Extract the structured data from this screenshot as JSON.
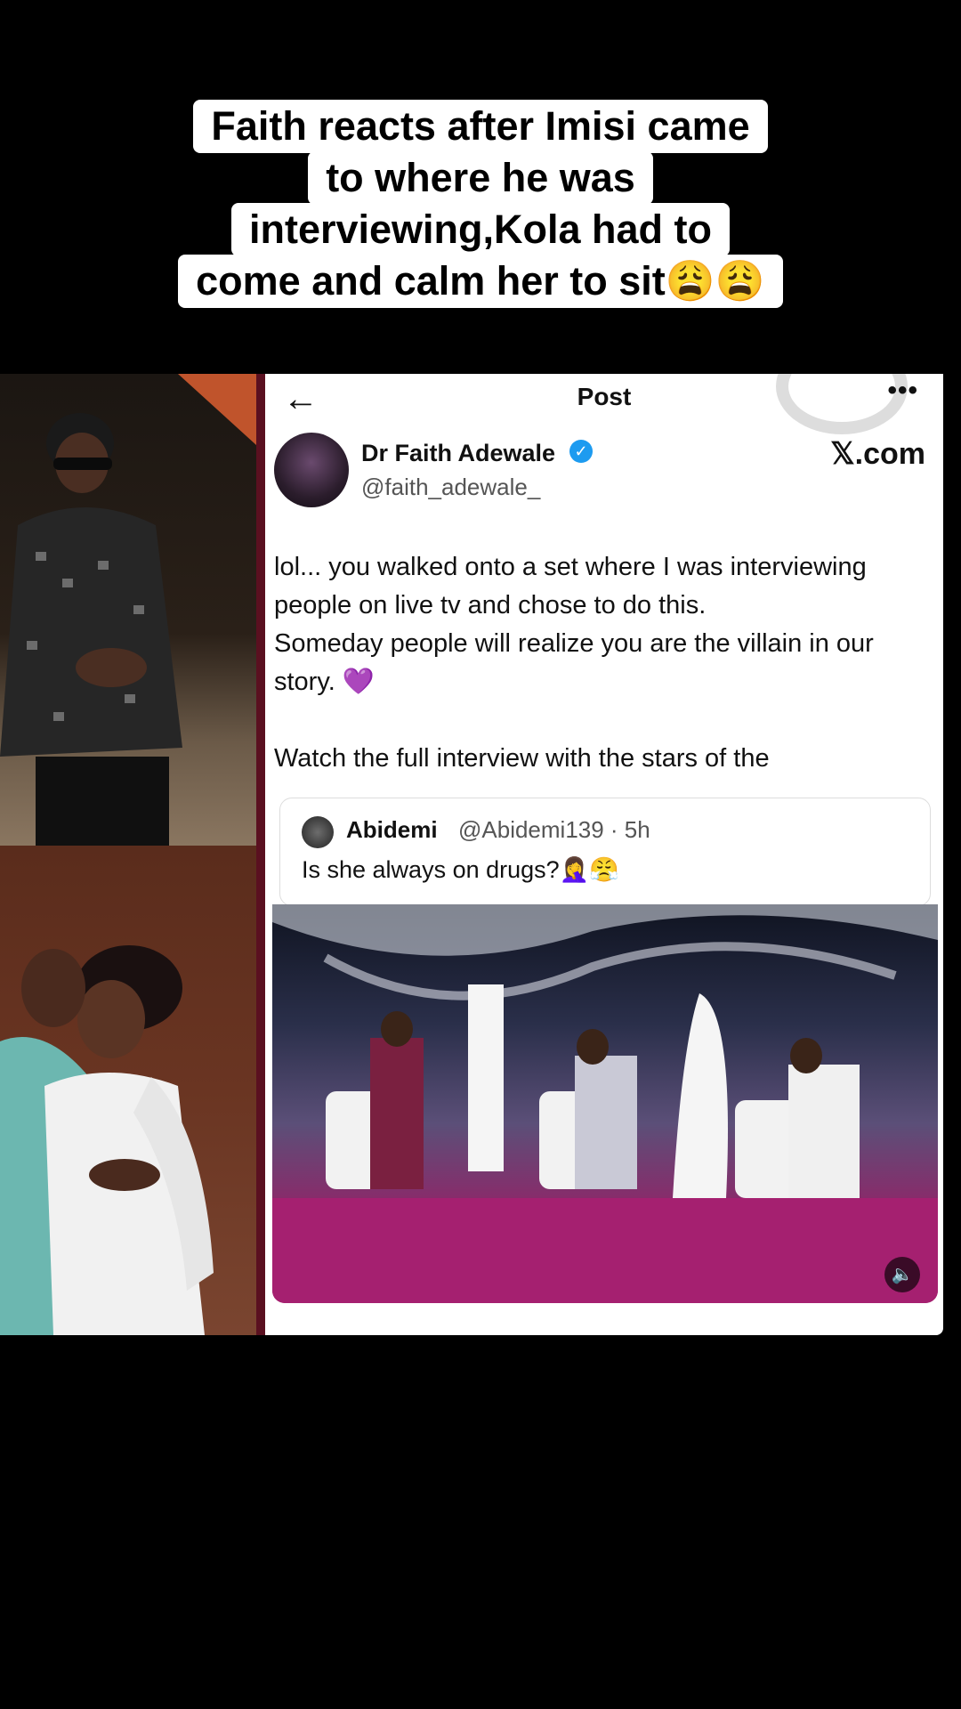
{
  "caption": {
    "lines": [
      "Faith reacts after Imisi came",
      "to where he was",
      "interviewing,Kola had to",
      "come and calm her to sit😩😩"
    ]
  },
  "post": {
    "back_icon": "arrow-left-icon",
    "title": "Post",
    "more_icon": "more-horizontal-icon",
    "author_name": "Dr Faith Adewale",
    "handle": "@faith_adewale_",
    "source": "𝕏.com",
    "text_lines": [
      "lol... you walked onto a set where I was interviewing",
      "people on live tv and chose to do this.",
      "Someday people will realize you are the villain in our",
      "story. 💜",
      "Watch the full interview with the stars of the"
    ],
    "quote": {
      "name": "Abidemi",
      "meta": "@Abidemi139 · 5h",
      "text": "Is she always on drugs?🤦‍♀️😤"
    },
    "volume_icon": "volume-icon"
  },
  "colors": {
    "verified": "#1d9bf0",
    "stage_pink": "#a7266e"
  }
}
